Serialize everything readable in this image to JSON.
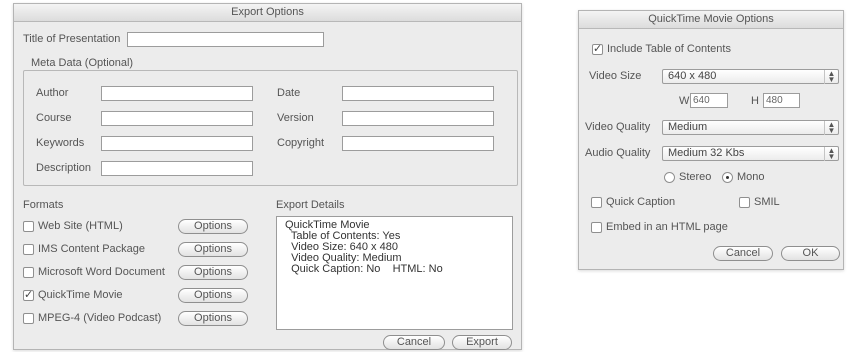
{
  "export": {
    "title": "Export Options",
    "title_label": "Title of Presentation",
    "title_value": "",
    "meta_label": "Meta Data (Optional)",
    "meta_left": [
      "Author",
      "Course",
      "Keywords",
      "Description"
    ],
    "meta_right": [
      "Date",
      "Version",
      "Copyright"
    ],
    "formats_label": "Formats",
    "formats": [
      {
        "label": "Web Site (HTML)",
        "checked": false
      },
      {
        "label": "IMS Content Package",
        "checked": false
      },
      {
        "label": "Microsoft Word Document",
        "checked": false
      },
      {
        "label": "QuickTime Movie",
        "checked": true
      },
      {
        "label": "MPEG-4 (Video Podcast)",
        "checked": false
      }
    ],
    "options_label": "Options",
    "details_label": "Export Details",
    "details_lines": [
      "QuickTime Movie",
      "  Table of Contents: Yes",
      "  Video Size: 640 x 480",
      "  Video Quality: Medium",
      "  Quick Caption: No    HTML: No"
    ],
    "cancel_label": "Cancel",
    "export_label": "Export"
  },
  "quicktime": {
    "title": "QuickTime Movie Options",
    "include_toc_label": "Include Table of Contents",
    "include_toc_checked": true,
    "video_size_label": "Video Size",
    "video_size_value": "640 x 480",
    "w_label": "W",
    "w_value": "640",
    "h_label": "H",
    "h_value": "480",
    "video_quality_label": "Video Quality",
    "video_quality_value": "Medium",
    "audio_quality_label": "Audio Quality",
    "audio_quality_value": "Medium 32 Kbs",
    "stereo_label": "Stereo",
    "mono_label": "Mono",
    "mono_selected": true,
    "quick_caption_label": "Quick Caption",
    "smil_label": "SMIL",
    "embed_label": "Embed in an HTML page",
    "cancel_label": "Cancel",
    "ok_label": "OK"
  },
  "icons": {
    "check": "✓",
    "select_arrows": "▲▼"
  }
}
